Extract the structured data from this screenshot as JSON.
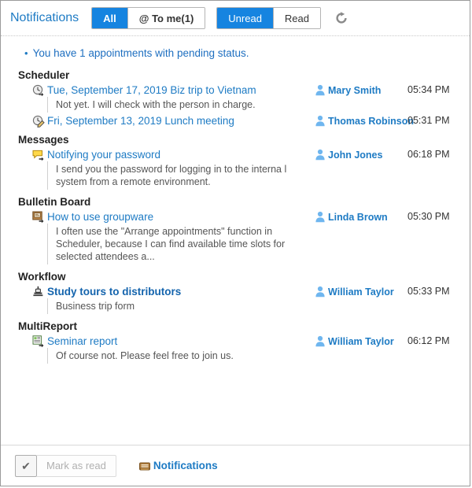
{
  "header": {
    "title": "Notifications",
    "target_tabs": [
      {
        "label": "All",
        "active": true
      },
      {
        "label": "@ To me(1)",
        "active": false
      }
    ],
    "status_tabs": [
      {
        "label": "Unread",
        "active": true
      },
      {
        "label": "Read",
        "active": false
      }
    ],
    "refresh_icon": "refresh-icon",
    "accent_color": "#1684e0"
  },
  "notice": {
    "bullet": "•",
    "text": "You have 1 appointments with pending status."
  },
  "sections": [
    {
      "title": "Scheduler",
      "items": [
        {
          "icon": "appointment-clock-icon",
          "title": "Tue, September 17, 2019 Biz trip to Vietnam",
          "bold": false,
          "body": "Not yet. I will check with the person in charge.",
          "user": "Mary Smith",
          "time": "05:34 PM"
        },
        {
          "icon": "appointment-edit-clock-icon",
          "title": "Fri, September 13, 2019 Lunch meeting",
          "bold": false,
          "body": "",
          "user": "Thomas Robinson",
          "time": "05:31 PM"
        }
      ]
    },
    {
      "title": "Messages",
      "items": [
        {
          "icon": "message-bubble-icon",
          "title": "Notifying your password",
          "bold": false,
          "body": "I send you the password for logging in to the interna l system from a remote environment.",
          "user": "John Jones",
          "time": "06:18 PM"
        }
      ]
    },
    {
      "title": "Bulletin Board",
      "items": [
        {
          "icon": "bulletin-board-icon",
          "title": "How to use groupware",
          "bold": false,
          "body": "I often use the \"Arrange appointments\" function in Scheduler, because I can find available time slots for selected attendees a...",
          "user": "Linda Brown",
          "time": "05:30 PM"
        }
      ]
    },
    {
      "title": "Workflow",
      "items": [
        {
          "icon": "workflow-stamp-icon",
          "title": "Study tours to distributors",
          "bold": true,
          "body": "Business trip form",
          "user": "William Taylor",
          "time": "05:33 PM"
        }
      ]
    },
    {
      "title": "MultiReport",
      "items": [
        {
          "icon": "multireport-doc-icon",
          "title": "Seminar report",
          "bold": false,
          "body": "Of course not. Please feel free to join us.",
          "user": "William Taylor",
          "time": "06:12 PM"
        }
      ]
    }
  ],
  "footer": {
    "checkbox_glyph": "✔",
    "mark_as_read_label": "Mark as read",
    "link_icon": "notifications-tray-icon",
    "link_label": "Notifications"
  }
}
